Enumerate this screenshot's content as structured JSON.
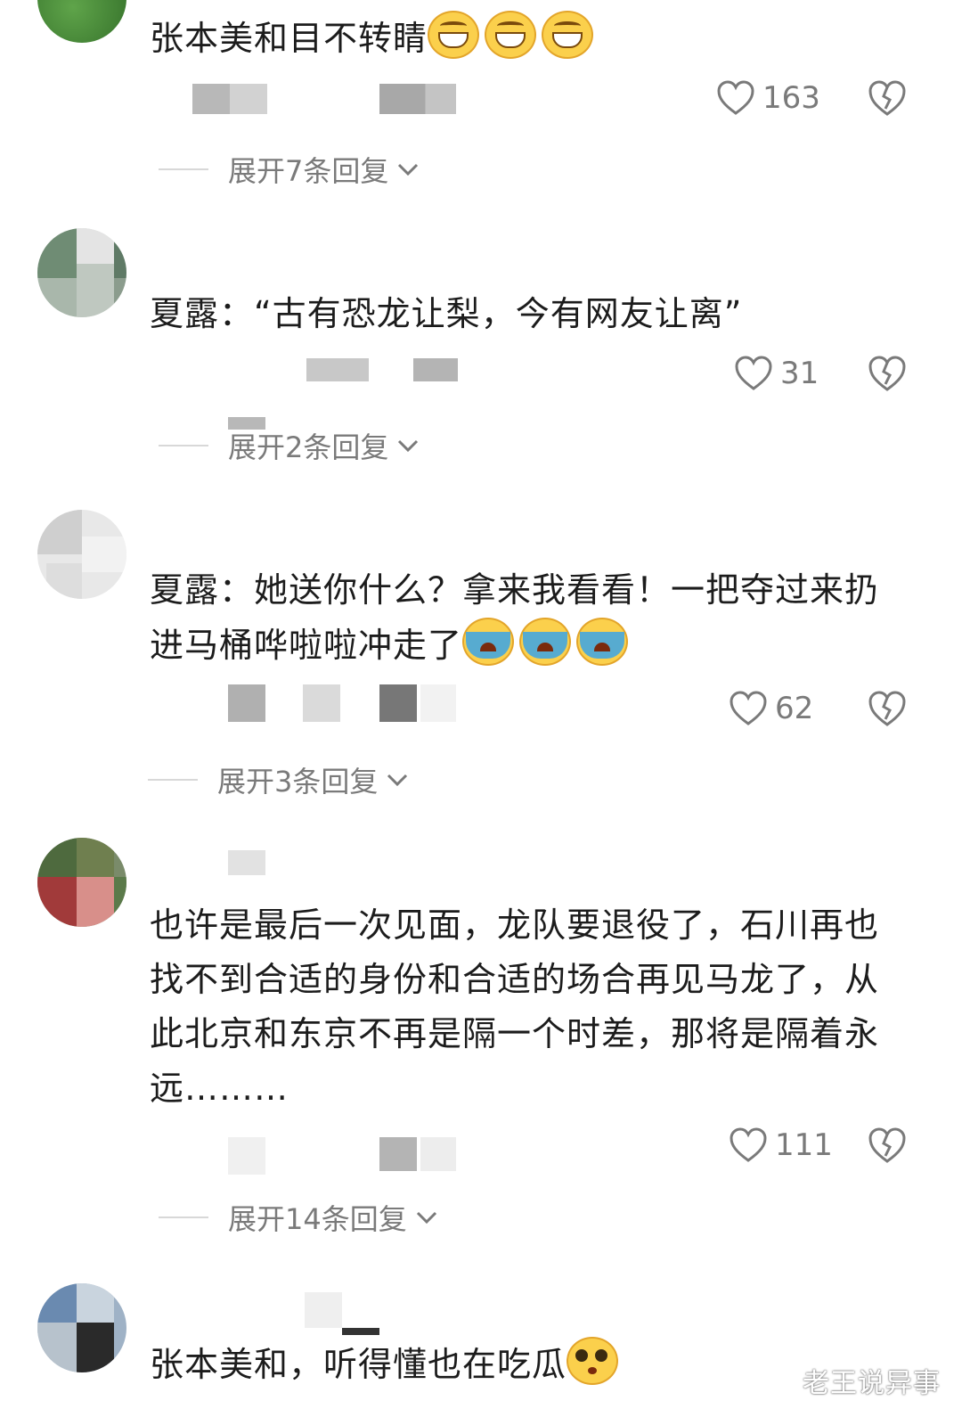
{
  "comments": [
    {
      "text": "张本美和目不转睛",
      "emoji": [
        "grin",
        "grin",
        "grin"
      ],
      "likes": "163",
      "expand": "展开7条回复"
    },
    {
      "text": "夏露：“古有恐龙让梨，今有网友让离”",
      "emoji": [],
      "likes": "31",
      "expand": "展开2条回复"
    },
    {
      "text_line1": "夏露：她送你什么？拿来我看看！一把夺过来扔",
      "text_line2": "进马桶哗啦啦冲走了",
      "emoji": [
        "cry",
        "cry",
        "cry"
      ],
      "likes": "62",
      "expand": "展开3条回复"
    },
    {
      "text_line1": "也许是最后一次见面，龙队要退役了，石川再也",
      "text_line2": "找不到合适的身份和合适的场合再见马龙了，从",
      "text_line3": "此北京和东京不再是隔一个时差，那将是隔着永",
      "text_line4": "远………",
      "likes": "111",
      "expand": "展开14条回复"
    },
    {
      "text": "张本美和，听得懂也在吃瓜",
      "emoji": [
        "pleading-face"
      ]
    }
  ],
  "watermark": "老王说异事",
  "colors": {
    "text": "#1c1c1c",
    "meta": "#9a9a9a",
    "icon": "#7a7a7a"
  }
}
